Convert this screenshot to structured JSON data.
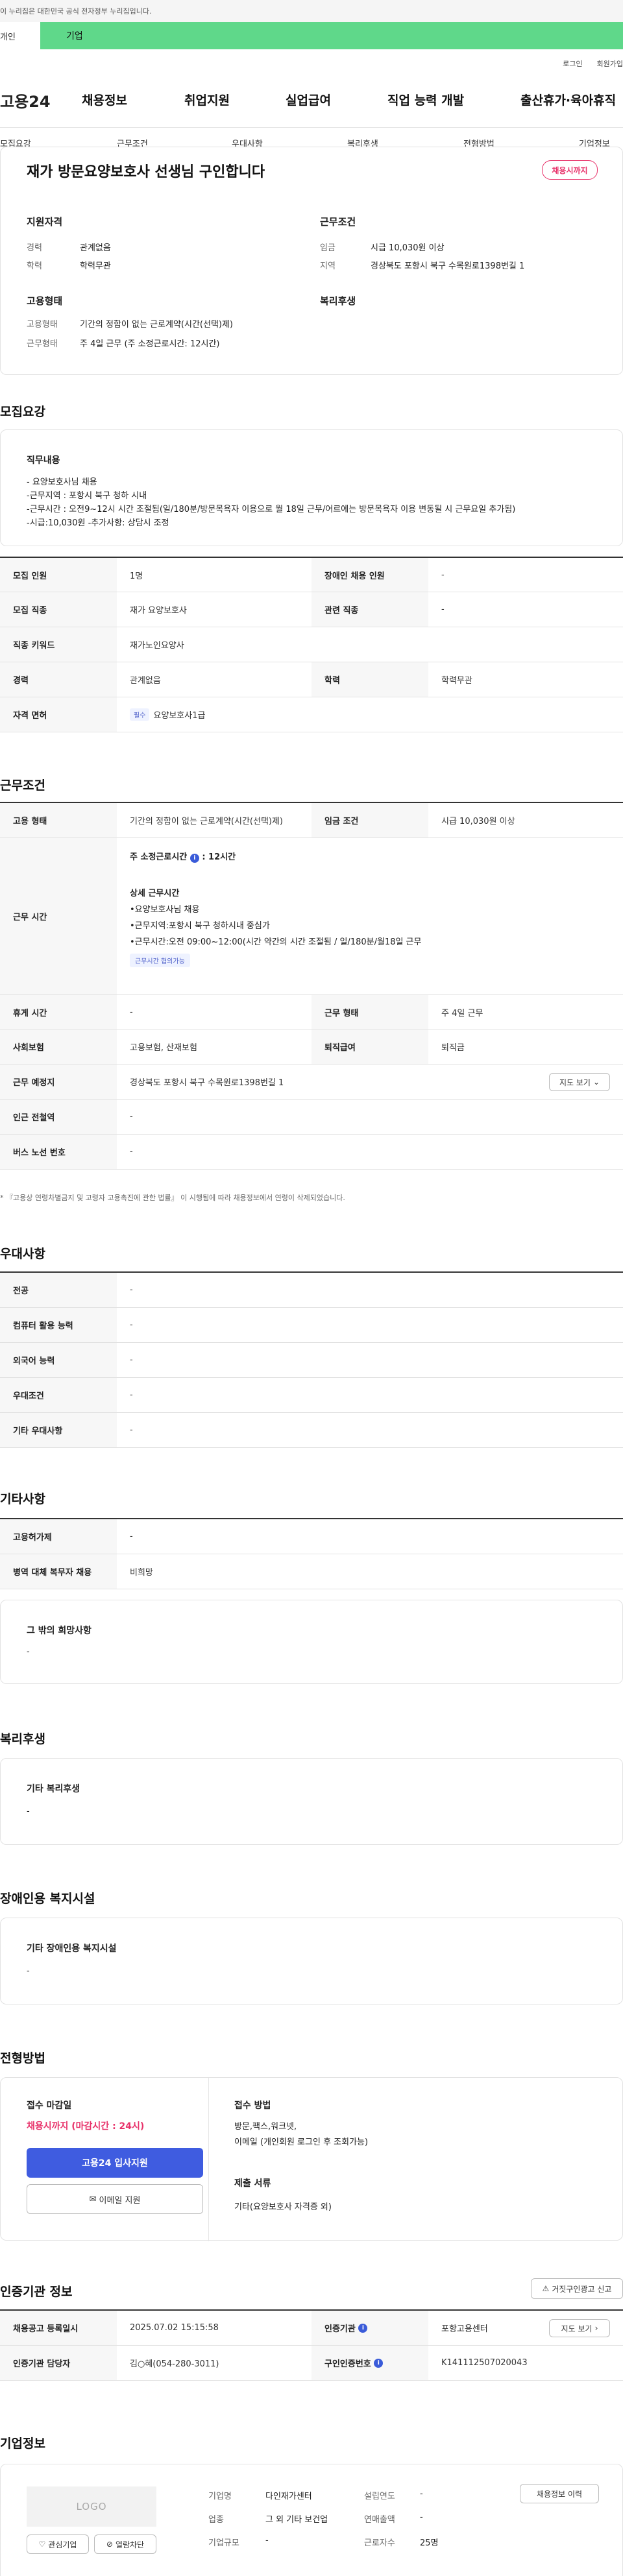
{
  "gov_banner": "이 누리집은 대한민국 공식 전자정부 누리집입니다.",
  "top_tabs": [
    "개인",
    "기업"
  ],
  "util_links": [
    "로그인",
    "회원가입"
  ],
  "logo": "고용24",
  "gnb": [
    "채용정보",
    "취업지원",
    "실업급여",
    "직업 능력 개발",
    "출산휴가·육아휴직"
  ],
  "subnav": [
    "모집요강",
    "근무조건",
    "우대사항",
    "복리후생",
    "전형방법",
    "기업정보"
  ],
  "summary": {
    "title": "재가 방문요양보호사 선생님 구인합니다",
    "deadline_badge": "채용시까지",
    "qual_heading": "지원자격",
    "work_heading": "근무조건",
    "emp_heading": "고용형태",
    "welfare_heading": "복리후생",
    "career_label": "경력",
    "career_value": "관계없음",
    "edu_label": "학력",
    "edu_value": "학력무관",
    "wage_label": "임금",
    "wage_value": "시급 10,030원 이상",
    "region_label": "지역",
    "region_value": "경상북도 포항시 북구 수목원로1398번길 1",
    "emptype_label": "고용형태",
    "emptype_value": "기간의 정함이 없는 근로계약(시간(선택)제)",
    "worktype_label": "근무형태",
    "worktype_value": "주 4일 근무 (주 소정근로시간: 12시간)"
  },
  "recruit": {
    "heading": "모집요강",
    "duty_title": "직무내용",
    "duty_lines": [
      "- 요양보호사님 채용",
      "-근무지역 : 포항시 북구 청하 시내",
      "-근무시간 : 오전9~12시  시간 조절됨(일/180분/방문목욕자 이용으로 월 18일 근무/어르에는 방문목욕자 이용 변동될 시 근무요일 추가됨)",
      "-시급:10,030원  -추가사항: 상담시 조정"
    ],
    "rows": {
      "headcount_l": "모집 인원",
      "headcount_v": "1명",
      "disabled_l": "장애인 채용 인원",
      "disabled_v": "-",
      "job_l": "모집 직종",
      "job_v": "재가 요양보호사",
      "rel_l": "관련 직종",
      "rel_v": "-",
      "kw_l": "직종 키워드",
      "kw_v": "재가노인요양사",
      "career_l": "경력",
      "career_v": "관계없음",
      "edu_l": "학력",
      "edu_v": "학력무관",
      "license_l": "자격 면허",
      "license_tag": "필수",
      "license_v": "요양보호사1급"
    }
  },
  "conditions": {
    "heading": "근무조건",
    "emptype_l": "고용 형태",
    "emptype_v": "기간의 정함이 없는 근로계약(시간(선택)제)",
    "wage_l": "임금 조건",
    "wage_v": "시급 10,030원 이상",
    "hours_l": "근무 시간",
    "hours_week": "주 소정근로시간",
    "hours_week_v": ": 12시간",
    "hours_detail_title": "상세 근무시간",
    "hours_detail": [
      "•요양보호사님 채용",
      "•근무지역:포항시 북구 청하시내 중심가",
      "•근무시간:오전 09:00~12:00(시간 약간의 시간 조절됨 / 일/180분/월18일 근무"
    ],
    "hours_tag": "근무시간 협의가능",
    "rest_l": "휴게 시간",
    "rest_v": "-",
    "workform_l": "근무 형태",
    "workform_v": "주 4일 근무",
    "insure_l": "사회보험",
    "insure_v": "고용보험, 산재보험",
    "retire_l": "퇴직급여",
    "retire_v": "퇴직금",
    "place_l": "근무 예정지",
    "place_v": "경상북도 포항시 북구 수목원로1398번길 1",
    "map_btn": "지도 보기",
    "subway_l": "인근 전철역",
    "subway_v": "-",
    "bus_l": "버스 노선 번호",
    "bus_v": "-",
    "note": "* 『고용상 연령차별금지 및 고령자 고용촉진에 관한 법률』 이 시행됨에 따라 채용정보에서 연령이 삭제되었습니다."
  },
  "pref": {
    "heading": "우대사항",
    "rows": [
      [
        "전공",
        "-"
      ],
      [
        "컴퓨터 활용 능력",
        "-"
      ],
      [
        "외국어 능력",
        "-"
      ],
      [
        "우대조건",
        "-"
      ],
      [
        "기타 우대사항",
        "-"
      ]
    ]
  },
  "etc": {
    "heading": "기타사항",
    "rows": [
      [
        "고용허가제",
        "-"
      ],
      [
        "병역 대체 복무자 채용",
        "비희망"
      ]
    ],
    "hope_title": "그 밖의 희망사항",
    "hope_v": "-"
  },
  "welfare": {
    "heading": "복리후생",
    "title": "기타 복리후생",
    "v": "-"
  },
  "disability": {
    "heading": "장애인용 복지시설",
    "title": "기타 장애인용 복지시설",
    "v": "-"
  },
  "selection": {
    "heading": "전형방법",
    "deadline_title": "접수 마감일",
    "deadline_v": "채용시까지 (마감시간 : 24시)",
    "apply_btn": "고용24 입사지원",
    "email_btn": "이메일 지원",
    "method_title": "접수 방법",
    "method_lines": [
      "방문,팩스,워크넷,",
      "이메일 (개인회원 로그인 후 조회가능)"
    ],
    "docs_title": "제출 서류",
    "docs_v": "기타(요양보호사 자격증 외)"
  },
  "cert": {
    "heading": "인증기관 정보",
    "report_btn": "거짓구인광고 신고",
    "reg_l": "채용공고 등록일시",
    "reg_v": "2025.07.02 15:15:58",
    "org_l": "인증기관",
    "org_v": "포항고용센터",
    "map_btn": "지도 보기",
    "mgr_l": "인증기관 담당자",
    "mgr_v": "김○혜(054-280-3011)",
    "num_l": "구인인증번호",
    "num_v": "K141112507020043"
  },
  "company": {
    "heading": "기업정보",
    "logo_text": "LOGO",
    "fav_btn": "관심기업",
    "block_btn": "열람차단",
    "history_btn": "채용정보 이력",
    "name_l": "기업명",
    "name_v": "다인재가센터",
    "founded_l": "설립연도",
    "founded_v": "-",
    "ind_l": "업종",
    "ind_v": "그 외 기타 보건업",
    "sales_l": "연매출액",
    "sales_v": "-",
    "size_l": "기업규모",
    "size_v": "-",
    "emp_l": "근로자수",
    "emp_v": "25명"
  }
}
